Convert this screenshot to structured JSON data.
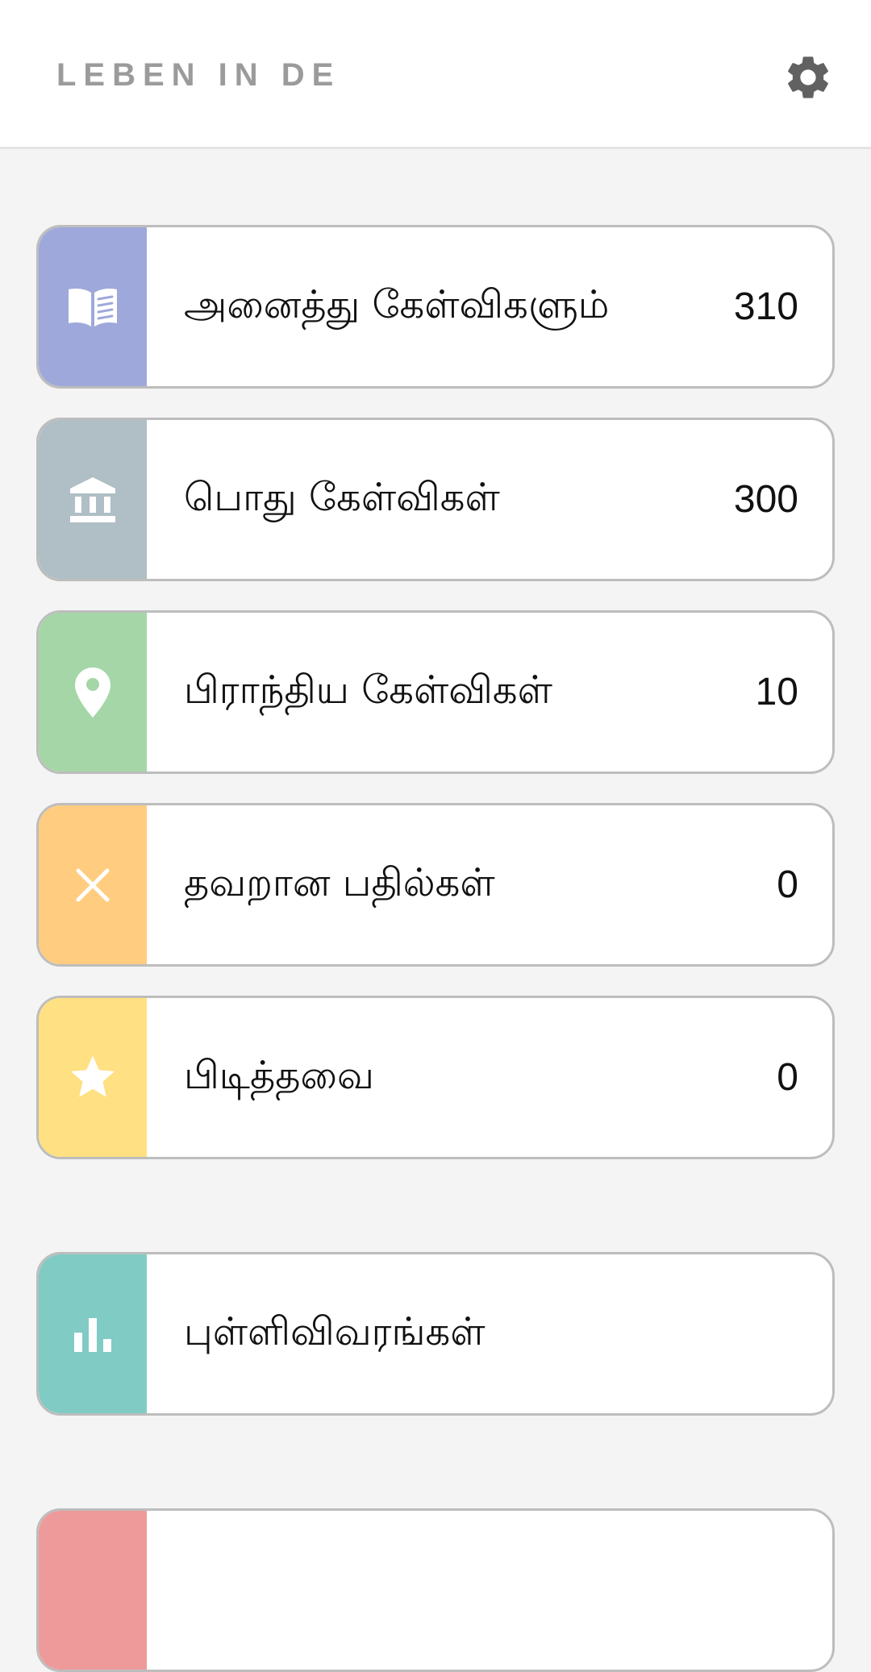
{
  "header": {
    "app_title": "LEBEN IN DE",
    "settings_icon": "gear-icon"
  },
  "menu": [
    {
      "key": "all",
      "label": "அனைத்து கேள்விகளும்",
      "count": "310",
      "icon": "open-book-icon",
      "color": "#9fa8da"
    },
    {
      "key": "general",
      "label": "பொது கேள்விகள்",
      "count": "300",
      "icon": "institution-icon",
      "color": "#b0bec5"
    },
    {
      "key": "regional",
      "label": "பிராந்திய கேள்விகள்",
      "count": "10",
      "icon": "location-pin-icon",
      "color": "#a5d6a7"
    },
    {
      "key": "wrong",
      "label": "தவறான பதில்கள்",
      "count": "0",
      "icon": "close-icon",
      "color": "#ffcc80"
    },
    {
      "key": "favorites",
      "label": "பிடித்தவை",
      "count": "0",
      "icon": "star-icon",
      "color": "#ffe082"
    }
  ],
  "statistics": {
    "label": "புள்ளிவிவரங்கள்",
    "icon": "bar-chart-icon",
    "color": "#80cbc4"
  },
  "partial_card": {
    "color": "#ef9a9a"
  }
}
